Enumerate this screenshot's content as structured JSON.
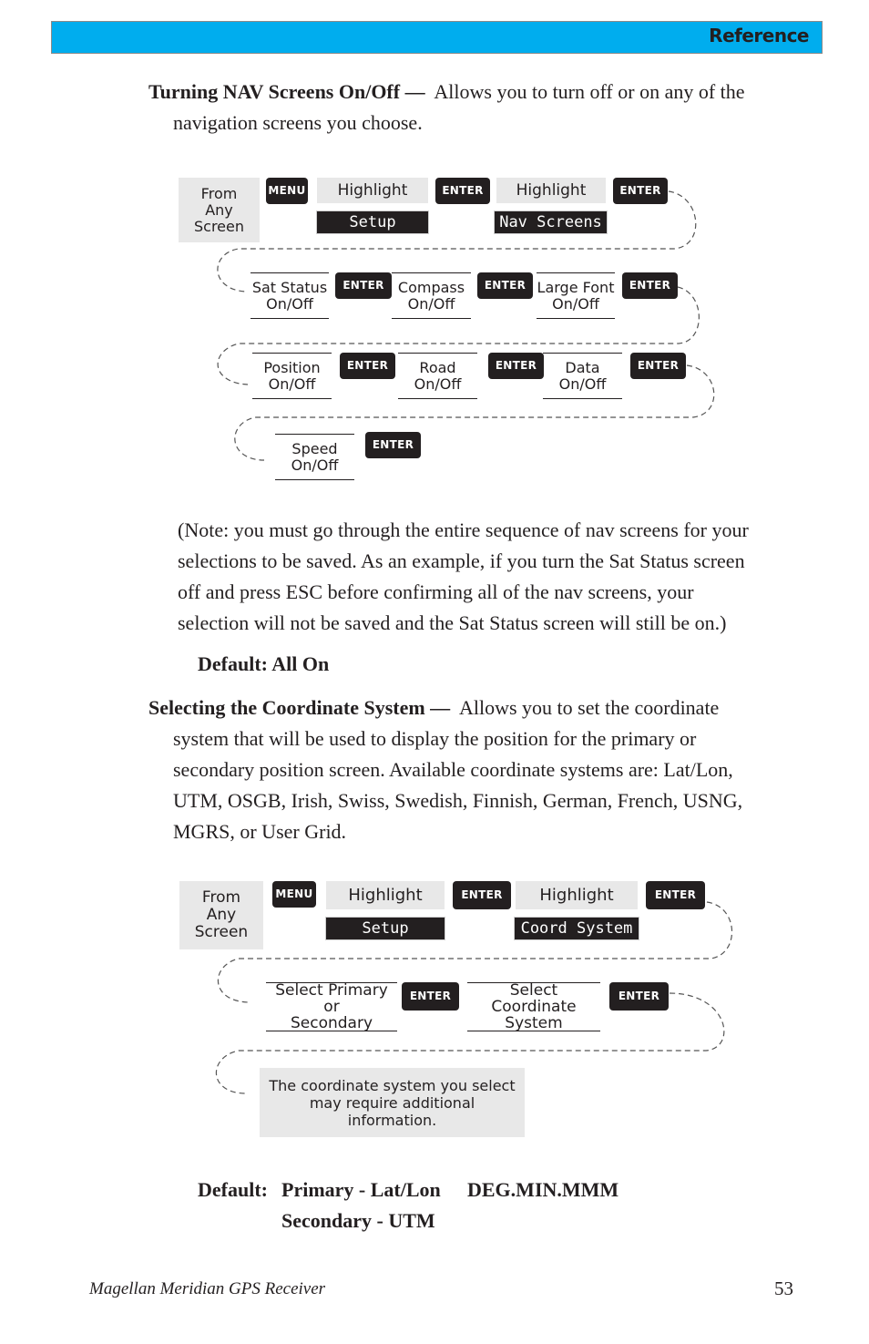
{
  "header": {
    "section_title": "Reference",
    "band_color": "#00adee"
  },
  "section1": {
    "heading": "Turning NAV Screens On/Off —",
    "intro_line1": "Allows you to turn off or on any of the",
    "intro_line2": "navigation screens you choose.",
    "diagram": {
      "start": [
        "From",
        "Any",
        "Screen"
      ],
      "keys": {
        "menu": "MENU",
        "enter": "ENTER"
      },
      "highlight_label": "Highlight",
      "screen1": "Setup",
      "screen2": "Nav Screens",
      "steps": [
        [
          "Sat Status",
          "On/Off"
        ],
        [
          "Compass",
          "On/Off"
        ],
        [
          "Large Font",
          "On/Off"
        ],
        [
          "Position",
          "On/Off"
        ],
        [
          "Road",
          "On/Off"
        ],
        [
          "Data",
          "On/Off"
        ],
        [
          "Speed",
          "On/Off"
        ]
      ]
    },
    "note_lines": [
      "(Note:  you must go through the entire sequence of nav screens for your",
      "selections to be saved.  As an example, if  you turn the Sat Status screen",
      "off and press ESC before confirming all of the nav screens, your",
      "selection will not be saved and the Sat Status screen will still be on.)"
    ],
    "default_text": "Default:  All On"
  },
  "section2": {
    "heading": "Selecting the Coordinate System —",
    "intro_lines": [
      "Allows you to set the coordinate",
      "system that will be used to display the position for the primary or",
      "secondary position screen.   Available coordinate systems are: Lat/Lon,",
      "UTM, OSGB, Irish, Swiss, Swedish, Finnish, German, French, USNG,",
      "MGRS, or User Grid."
    ],
    "diagram": {
      "start": [
        "From",
        "Any",
        "Screen"
      ],
      "keys": {
        "menu": "MENU",
        "enter": "ENTER"
      },
      "highlight_label": "Highlight",
      "screen1": "Setup",
      "screen2": "Coord System",
      "steps": [
        [
          "Select Primary or",
          "Secondary"
        ],
        [
          "Select Coordinate",
          "System"
        ]
      ],
      "info": [
        "The coordinate system you select",
        "may require additional",
        "information."
      ]
    },
    "default_label": "Default:",
    "default_primary": "Primary - Lat/Lon",
    "default_format": "DEG.MIN.MMM",
    "default_secondary": "Secondary - UTM"
  },
  "footer": {
    "title": "Magellan Meridian GPS Receiver",
    "page_number": "53"
  }
}
